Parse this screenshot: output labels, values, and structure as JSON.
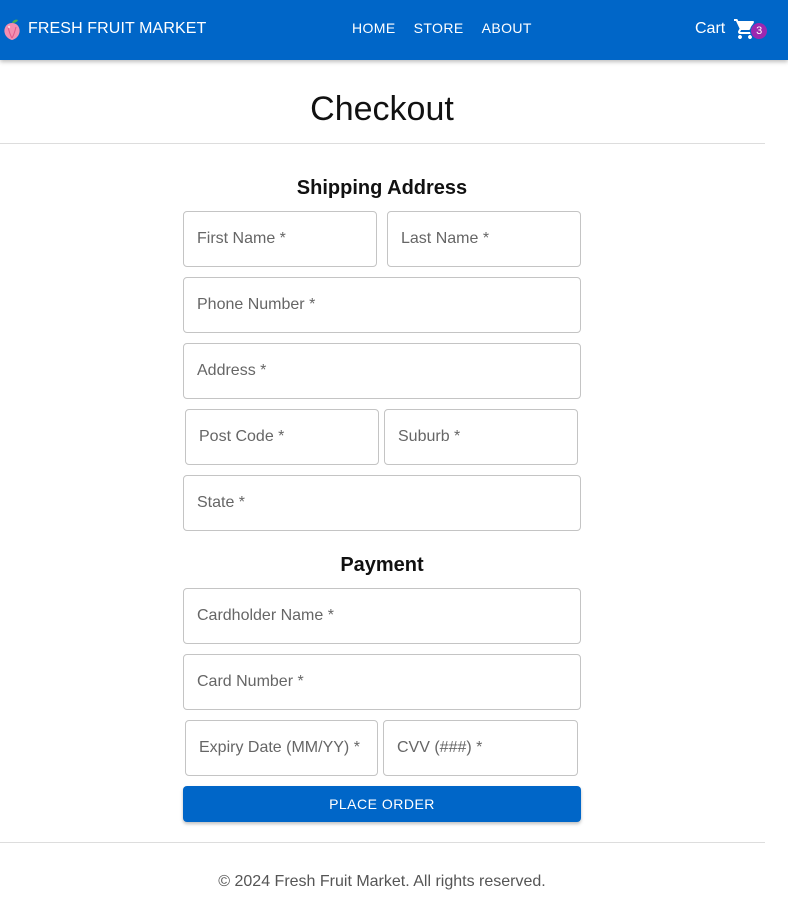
{
  "header": {
    "brand": "FRESH FRUIT MARKET",
    "logo_icon": "fruit-logo-icon",
    "nav": [
      {
        "label": "HOME"
      },
      {
        "label": "STORE"
      },
      {
        "label": "ABOUT"
      }
    ],
    "cart_label": "Cart",
    "cart_icon": "shopping-cart-icon",
    "cart_count": "3",
    "colors": {
      "bar": "#0066c8",
      "badge": "#9c27b0"
    }
  },
  "page": {
    "title": "Checkout"
  },
  "shipping": {
    "title": "Shipping Address",
    "first_name": {
      "placeholder": "First Name *",
      "value": ""
    },
    "last_name": {
      "placeholder": "Last Name *",
      "value": ""
    },
    "phone": {
      "placeholder": "Phone Number *",
      "value": ""
    },
    "address": {
      "placeholder": "Address *",
      "value": ""
    },
    "post_code": {
      "placeholder": "Post Code *",
      "value": ""
    },
    "suburb": {
      "placeholder": "Suburb *",
      "value": ""
    },
    "state": {
      "placeholder": "State *",
      "value": ""
    }
  },
  "payment": {
    "title": "Payment",
    "cardholder": {
      "placeholder": "Cardholder Name *",
      "value": ""
    },
    "card_number": {
      "placeholder": "Card Number *",
      "value": ""
    },
    "expiry": {
      "placeholder": "Expiry Date (MM/YY) *",
      "value": ""
    },
    "cvv": {
      "placeholder": "CVV (###) *",
      "value": ""
    }
  },
  "actions": {
    "place_order": "PLACE ORDER"
  },
  "footer": {
    "text": "© 2024 Fresh Fruit Market. All rights reserved."
  }
}
